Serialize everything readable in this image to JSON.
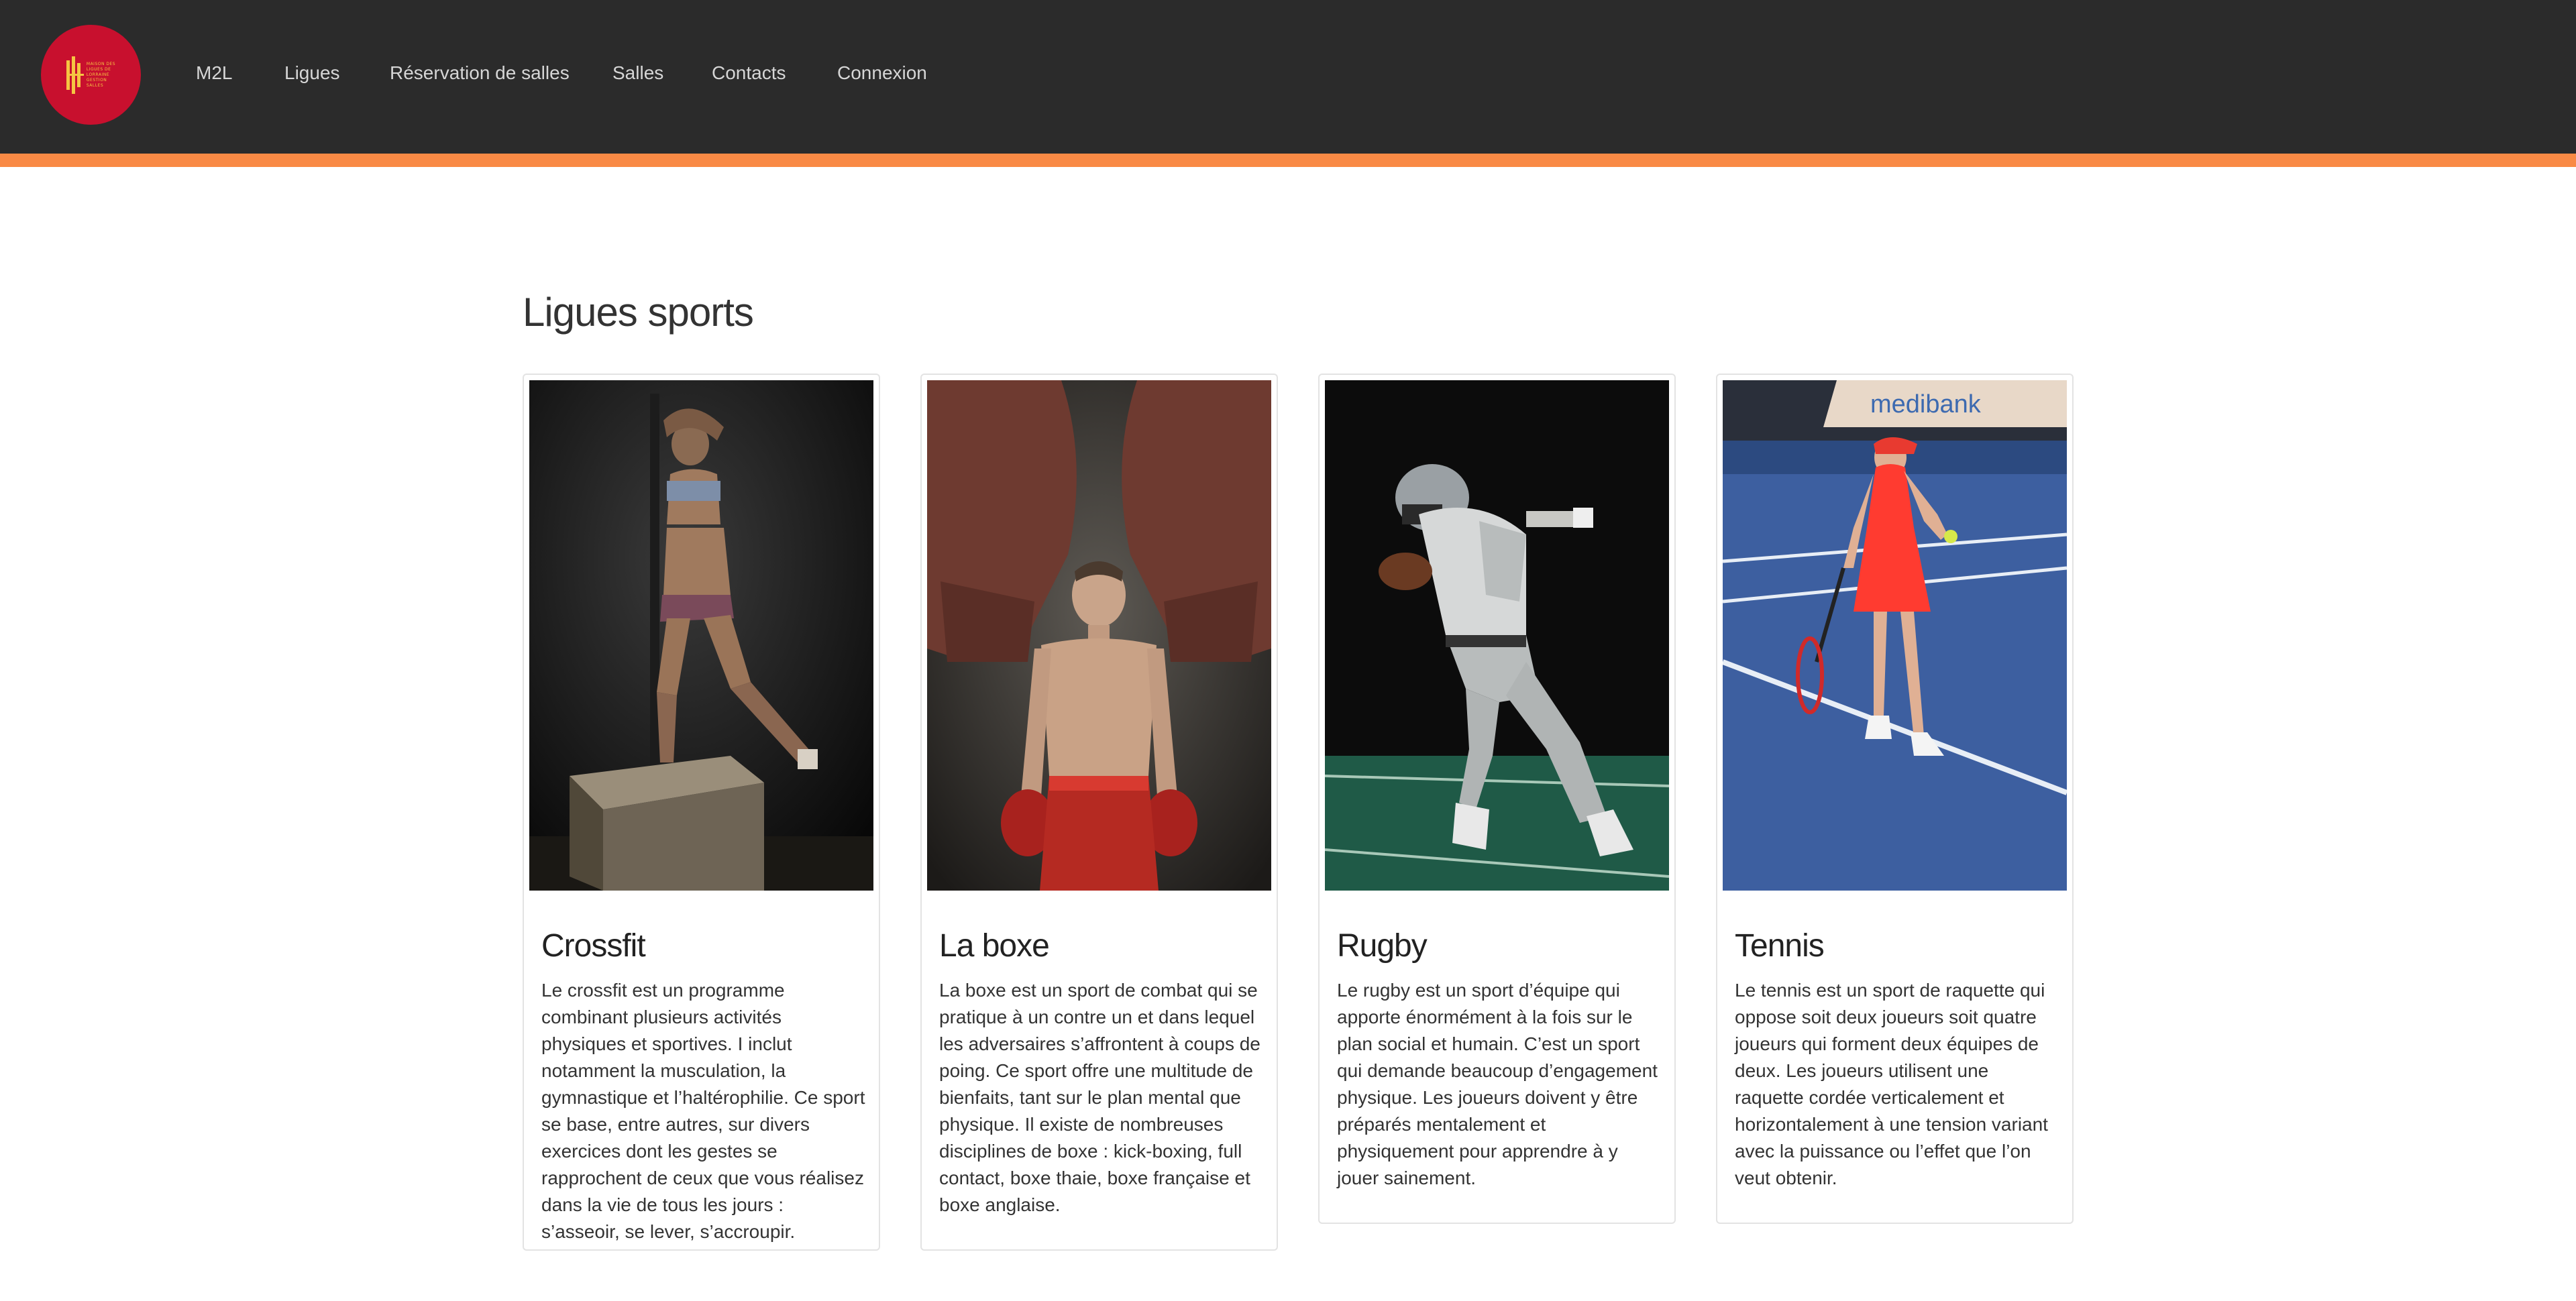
{
  "header": {
    "logo_text": [
      "MAISON DES",
      "LIGUES DE",
      "LORRAINE",
      "GESTION",
      "SALLES"
    ],
    "nav": [
      {
        "label": "M2L"
      },
      {
        "label": "Ligues"
      },
      {
        "label": "Réservation de salles"
      },
      {
        "label": "Salles"
      },
      {
        "label": "Contacts"
      },
      {
        "label": "Connexion"
      }
    ],
    "colors": {
      "navbar_bg": "#2b2b2b",
      "accent_stripe": "#f98a45",
      "logo_bg": "#c8102e",
      "logo_fg": "#f5c542"
    }
  },
  "main": {
    "title": "Ligues sports",
    "cards": [
      {
        "title": "Crossfit",
        "image": "crossfit-photo",
        "text": "Le crossfit est un programme combinant plusieurs activités physiques et sportives. I inclut notamment la musculation, la gymnastique et l’haltérophilie. Ce sport se base, entre autres, sur divers exercices dont les gestes se rapprochent de ceux que vous réalisez dans la vie de tous les jours : s’asseoir, se lever, s’accroupir."
      },
      {
        "title": "La boxe",
        "image": "boxing-photo",
        "text": "La boxe est un sport de combat qui se pratique à un contre un et dans lequel les adversaires s’affrontent à coups de poing. Ce sport offre une multitude de bienfaits, tant sur le plan mental que physique. Il existe de nombreuses disciplines de boxe : kick-boxing, full contact, boxe thaie, boxe française et boxe anglaise."
      },
      {
        "title": "Rugby",
        "image": "rugby-photo",
        "text": "Le rugby est un sport d’équipe qui apporte énormément à la fois sur le plan social et humain. C’est un sport qui demande beaucoup d’engagement physique. Les joueurs doivent y être préparés mentalement et physiquement pour apprendre à y jouer sainement."
      },
      {
        "title": "Tennis",
        "image": "tennis-photo",
        "image_caption": "medibank",
        "text": "Le tennis est un sport de raquette qui oppose soit deux joueurs soit quatre joueurs qui forment deux équipes de deux. Les joueurs utilisent une raquette cordée verticalement et horizontalement à une tension variant avec la puissance ou l’effet que l’on veut obtenir."
      }
    ]
  }
}
